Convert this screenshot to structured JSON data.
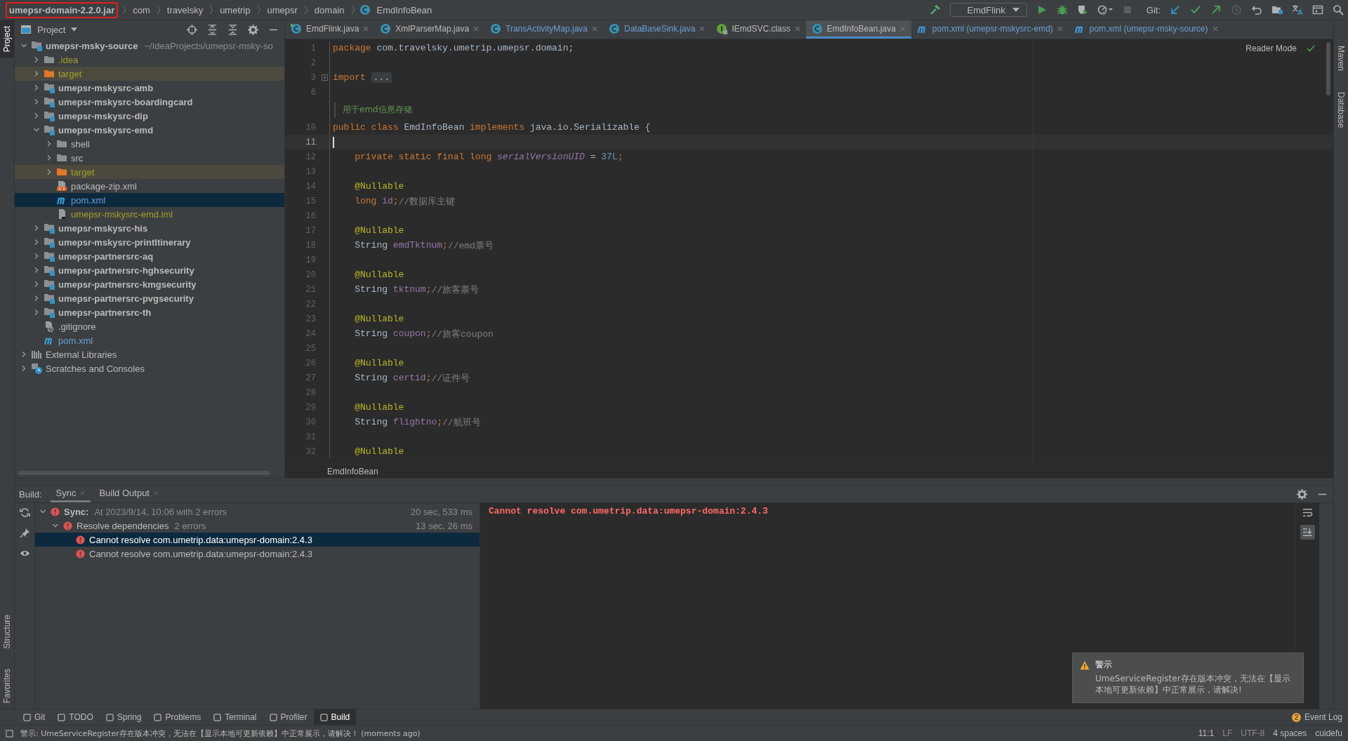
{
  "breadcrumbs": [
    {
      "label": "umepsr-domain-2.2.0.jar",
      "kind": "jar",
      "marked": true
    },
    {
      "label": "com",
      "kind": "package",
      "marked": false
    },
    {
      "label": "travelsky",
      "kind": "package",
      "marked": false
    },
    {
      "label": "umetrip",
      "kind": "package",
      "marked": false
    },
    {
      "label": "umepsr",
      "kind": "package",
      "marked": false
    },
    {
      "label": "domain",
      "kind": "package",
      "marked": false
    },
    {
      "label": "EmdInfoBean",
      "kind": "class",
      "marked": false
    }
  ],
  "run_config": {
    "label": "EmdFlink"
  },
  "git_label": "Git:",
  "left_strip": [
    {
      "label": "Project",
      "selected": true
    }
  ],
  "left_strip_bottom": [
    {
      "label": "Structure"
    },
    {
      "label": "Favorites"
    }
  ],
  "right_strip": [
    {
      "label": "Maven"
    },
    {
      "label": "Database"
    }
  ],
  "project": {
    "title": "Project",
    "tree": [
      {
        "label": "umepsr-msky-source",
        "hint": "~/IdeaProjects/umepsr-msky-so",
        "kind": "module",
        "ignored": false,
        "modified": false,
        "expanded": true,
        "selected": false,
        "children": [
          {
            "label": ".idea",
            "kind": "folder",
            "ignored": true,
            "modified": false,
            "expanded": false,
            "selected": false
          },
          {
            "label": "target",
            "kind": "excluded",
            "ignored": true,
            "modified": false,
            "expanded": false,
            "selected": false
          },
          {
            "label": "umepsr-mskysrc-amb",
            "kind": "module",
            "ignored": false,
            "modified": false,
            "expanded": false,
            "selected": false
          },
          {
            "label": "umepsr-mskysrc-boardingcard",
            "kind": "module",
            "ignored": false,
            "modified": false,
            "expanded": false,
            "selected": false
          },
          {
            "label": "umepsr-mskysrc-dip",
            "kind": "module",
            "ignored": false,
            "modified": false,
            "expanded": false,
            "selected": false
          },
          {
            "label": "umepsr-mskysrc-emd",
            "kind": "module",
            "ignored": false,
            "modified": false,
            "expanded": true,
            "selected": false,
            "children": [
              {
                "label": "shell",
                "kind": "folder",
                "ignored": false,
                "modified": false,
                "expanded": false,
                "selected": false
              },
              {
                "label": "src",
                "kind": "folder",
                "ignored": false,
                "modified": false,
                "expanded": false,
                "selected": false
              },
              {
                "label": "target",
                "kind": "excluded",
                "ignored": true,
                "modified": false,
                "expanded": false,
                "selected": false
              },
              {
                "label": "package-zip.xml",
                "kind": "xml",
                "ignored": false,
                "modified": false,
                "selected": false
              },
              {
                "label": "pom.xml",
                "kind": "maven",
                "ignored": false,
                "modified": true,
                "selected": true
              },
              {
                "label": "umepsr-mskysrc-emd.iml",
                "kind": "iml",
                "ignored": true,
                "modified": false,
                "selected": false
              }
            ]
          },
          {
            "label": "umepsr-mskysrc-his",
            "kind": "module",
            "ignored": false,
            "modified": false,
            "expanded": false,
            "selected": false
          },
          {
            "label": "umepsr-mskysrc-printItinerary",
            "kind": "module",
            "ignored": false,
            "modified": false,
            "expanded": false,
            "selected": false
          },
          {
            "label": "umepsr-partnersrc-aq",
            "kind": "module",
            "ignored": false,
            "modified": false,
            "expanded": false,
            "selected": false
          },
          {
            "label": "umepsr-partnersrc-hghsecurity",
            "kind": "module",
            "ignored": false,
            "modified": false,
            "expanded": false,
            "selected": false
          },
          {
            "label": "umepsr-partnersrc-kmgsecurity",
            "kind": "module",
            "ignored": false,
            "modified": false,
            "expanded": false,
            "selected": false
          },
          {
            "label": "umepsr-partnersrc-pvgsecurity",
            "kind": "module",
            "ignored": false,
            "modified": false,
            "expanded": false,
            "selected": false
          },
          {
            "label": "umepsr-partnersrc-th",
            "kind": "module",
            "ignored": false,
            "modified": false,
            "expanded": false,
            "selected": false
          },
          {
            "label": ".gitignore",
            "kind": "gitignore",
            "ignored": false,
            "modified": false,
            "selected": false
          },
          {
            "label": "pom.xml",
            "kind": "maven",
            "ignored": false,
            "modified": true,
            "selected": false
          }
        ]
      },
      {
        "label": "External Libraries",
        "kind": "libraries",
        "ignored": false,
        "modified": false,
        "expanded": false,
        "selected": false
      },
      {
        "label": "Scratches and Consoles",
        "kind": "scratches",
        "ignored": false,
        "modified": false,
        "expanded": false,
        "selected": false
      }
    ]
  },
  "editor": {
    "tabs": [
      {
        "label": "EmdFlink.java",
        "kind": "runnable-class",
        "modified": false,
        "selected": false
      },
      {
        "label": "XmlParserMap.java",
        "kind": "class",
        "modified": false,
        "selected": false
      },
      {
        "label": "TransActivityMap.java",
        "kind": "class",
        "modified": true,
        "selected": false
      },
      {
        "label": "DataBaseSink.java",
        "kind": "class",
        "modified": true,
        "selected": false
      },
      {
        "label": "IEmdSVC.class",
        "kind": "interface",
        "modified": false,
        "selected": false
      },
      {
        "label": "EmdInfoBean.java",
        "kind": "class",
        "modified": false,
        "selected": true
      },
      {
        "label": "pom.xml (umepsr-mskysrc-emd)",
        "kind": "maven",
        "modified": true,
        "selected": false
      },
      {
        "label": "pom.xml (umepsr-msky-source)",
        "kind": "maven",
        "modified": true,
        "selected": false
      }
    ],
    "reader_mode": "Reader Mode",
    "lines": [
      {
        "kind": "code",
        "number": "1",
        "current": false,
        "tokens": [
          {
            "kind": "keyword",
            "text": "package"
          },
          {
            "kind": "plain",
            "text": " com.travelsky.umetrip.umepsr.domain;"
          }
        ]
      },
      {
        "kind": "code",
        "number": "2",
        "current": false
      },
      {
        "kind": "code",
        "number": "3",
        "current": false,
        "tokens": [
          {
            "kind": "keyword",
            "text": "import "
          },
          {
            "kind": "folded",
            "text": "..."
          }
        ]
      },
      {
        "kind": "code",
        "number": "6",
        "current": false
      },
      {
        "kind": "doc",
        "text": "用于emd信息存储"
      },
      {
        "kind": "code",
        "number": "10",
        "current": false,
        "tokens": [
          {
            "kind": "keyword",
            "text": "public class"
          },
          {
            "kind": "plain",
            "text": " EmdInfoBean "
          },
          {
            "kind": "keyword",
            "text": "implements"
          },
          {
            "kind": "plain",
            "text": " java.io.Serializable {"
          }
        ]
      },
      {
        "kind": "code",
        "number": "11",
        "current": true
      },
      {
        "kind": "code",
        "number": "12",
        "current": false,
        "tokens": [
          {
            "kind": "keyword",
            "text": "    private static final long "
          },
          {
            "kind": "static",
            "text": "serialVersionUID"
          },
          {
            "kind": "plain",
            "text": " = "
          },
          {
            "kind": "number",
            "text": "37L"
          },
          {
            "kind": "keyword",
            "text": ";"
          }
        ]
      },
      {
        "kind": "code",
        "number": "13",
        "current": false
      },
      {
        "kind": "code",
        "number": "14",
        "current": false,
        "tokens": [
          {
            "kind": "annotation",
            "text": "    @Nullable"
          }
        ]
      },
      {
        "kind": "code",
        "number": "15",
        "current": false,
        "tokens": [
          {
            "kind": "keyword",
            "text": "    long "
          },
          {
            "kind": "field",
            "text": "id"
          },
          {
            "kind": "keyword",
            "text": ";"
          },
          {
            "kind": "comment",
            "text": "//数据库主键"
          }
        ]
      },
      {
        "kind": "code",
        "number": "16",
        "current": false
      },
      {
        "kind": "code",
        "number": "17",
        "current": false,
        "tokens": [
          {
            "kind": "annotation",
            "text": "    @Nullable"
          }
        ]
      },
      {
        "kind": "code",
        "number": "18",
        "current": false,
        "tokens": [
          {
            "kind": "plain",
            "text": "    String "
          },
          {
            "kind": "field",
            "text": "emdTktnum"
          },
          {
            "kind": "keyword",
            "text": ";"
          },
          {
            "kind": "comment",
            "text": "//emd票号"
          }
        ]
      },
      {
        "kind": "code",
        "number": "19",
        "current": false
      },
      {
        "kind": "code",
        "number": "20",
        "current": false,
        "tokens": [
          {
            "kind": "annotation",
            "text": "    @Nullable"
          }
        ]
      },
      {
        "kind": "code",
        "number": "21",
        "current": false,
        "tokens": [
          {
            "kind": "plain",
            "text": "    String "
          },
          {
            "kind": "field",
            "text": "tktnum"
          },
          {
            "kind": "keyword",
            "text": ";"
          },
          {
            "kind": "comment",
            "text": "//旅客票号"
          }
        ]
      },
      {
        "kind": "code",
        "number": "22",
        "current": false
      },
      {
        "kind": "code",
        "number": "23",
        "current": false,
        "tokens": [
          {
            "kind": "annotation",
            "text": "    @Nullable"
          }
        ]
      },
      {
        "kind": "code",
        "number": "24",
        "current": false,
        "tokens": [
          {
            "kind": "plain",
            "text": "    String "
          },
          {
            "kind": "field",
            "text": "coupon"
          },
          {
            "kind": "keyword",
            "text": ";"
          },
          {
            "kind": "comment",
            "text": "//旅客coupon"
          }
        ]
      },
      {
        "kind": "code",
        "number": "25",
        "current": false
      },
      {
        "kind": "code",
        "number": "26",
        "current": false,
        "tokens": [
          {
            "kind": "annotation",
            "text": "    @Nullable"
          }
        ]
      },
      {
        "kind": "code",
        "number": "27",
        "current": false,
        "tokens": [
          {
            "kind": "plain",
            "text": "    String "
          },
          {
            "kind": "field",
            "text": "certid"
          },
          {
            "kind": "keyword",
            "text": ";"
          },
          {
            "kind": "comment",
            "text": "//证件号"
          }
        ]
      },
      {
        "kind": "code",
        "number": "28",
        "current": false
      },
      {
        "kind": "code",
        "number": "29",
        "current": false,
        "tokens": [
          {
            "kind": "annotation",
            "text": "    @Nullable"
          }
        ]
      },
      {
        "kind": "code",
        "number": "30",
        "current": false,
        "tokens": [
          {
            "kind": "plain",
            "text": "    String "
          },
          {
            "kind": "field",
            "text": "flightno"
          },
          {
            "kind": "keyword",
            "text": ";"
          },
          {
            "kind": "comment",
            "text": "//航班号"
          }
        ]
      },
      {
        "kind": "code",
        "number": "31",
        "current": false
      },
      {
        "kind": "code",
        "number": "32",
        "current": false,
        "tokens": [
          {
            "kind": "annotation",
            "text": "    @Nullable"
          }
        ]
      }
    ],
    "breadcrumb": "EmdInfoBean"
  },
  "build": {
    "title": "Build:",
    "tabs": [
      {
        "label": "Sync",
        "selected": true
      },
      {
        "label": "Build Output",
        "selected": false
      }
    ],
    "tree": [
      {
        "label": "Sync:",
        "detail": "At 2023/9/14, 10:06 with 2 errors",
        "time": "20 sec, 533 ms",
        "expanded": true,
        "selected": false,
        "children": [
          {
            "label": "Resolve dependencies",
            "detail": "2 errors",
            "time": "13 sec, 26 ms",
            "expanded": true,
            "selected": false,
            "children": [
              {
                "label": "Cannot resolve com.umetrip.data:umepsr-domain:2.4.3",
                "selected": true
              },
              {
                "label": "Cannot resolve com.umetrip.data:umepsr-domain:2.4.3",
                "selected": false
              }
            ]
          }
        ]
      }
    ],
    "console": [
      "Cannot resolve com.umetrip.data:umepsr-domain:2.4.3"
    ]
  },
  "notification": {
    "title": "警示",
    "body": "UmeServiceRegister存在版本冲突，无法在【显示本地可更新依赖】中正常展示，请解决!"
  },
  "tool_windows": [
    {
      "label": "Git",
      "selected": false
    },
    {
      "label": "TODO",
      "selected": false
    },
    {
      "label": "Spring",
      "selected": false
    },
    {
      "label": "Problems",
      "selected": false
    },
    {
      "label": "Terminal",
      "selected": false
    },
    {
      "label": "Profiler",
      "selected": false
    },
    {
      "label": "Build",
      "selected": true
    }
  ],
  "event_log": {
    "label": "Event Log",
    "count": "2"
  },
  "status_bar": {
    "message": "警示: UmeServiceRegister存在版本冲突，无法在【显示本地可更新依赖】中正常展示，请解决！ (moments ago)",
    "position": "11:1",
    "line_separator": "LF",
    "encoding": "UTF-8",
    "indent": "4 spaces",
    "user": "cuidefu"
  }
}
